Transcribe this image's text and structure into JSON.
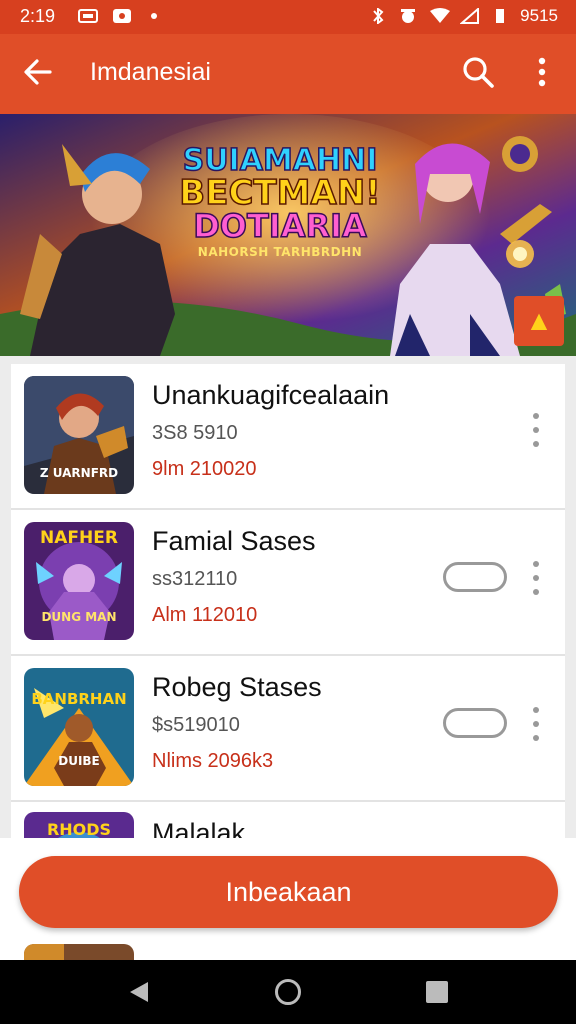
{
  "status": {
    "time": "2:19",
    "right_text": "9515"
  },
  "appbar": {
    "title": "Imdanesiai"
  },
  "banner": {
    "line1": "SUIAMAHNI",
    "line2": "BECTMAN!",
    "line3": "DOTIARIA",
    "line4": "NAHORSH TARHBRDHN"
  },
  "list": {
    "items": [
      {
        "title": "Unankuagifcealaain",
        "subtitle": "3S8 5910",
        "meta": "9lm 210020",
        "thumb_text": "Z UARNFRD"
      },
      {
        "title": "Famial Sases",
        "subtitle": "ss312110",
        "meta": "Alm 112010",
        "thumb_text_top": "NAFHER",
        "thumb_text_bottom": "DUNG MAN"
      },
      {
        "title": "Robeg Stases",
        "subtitle": "$s519010",
        "meta": "Nlims 2096k3",
        "thumb_text_top": "BANBRHAN",
        "thumb_text_bottom": "DUIBE"
      },
      {
        "title": "Malalak",
        "thumb_text_top": "RHODS"
      }
    ]
  },
  "cta": {
    "label": "Inbeakaan"
  },
  "colors": {
    "primary": "#e04e28",
    "status": "#d7401f",
    "meta_red": "#c7301a"
  }
}
